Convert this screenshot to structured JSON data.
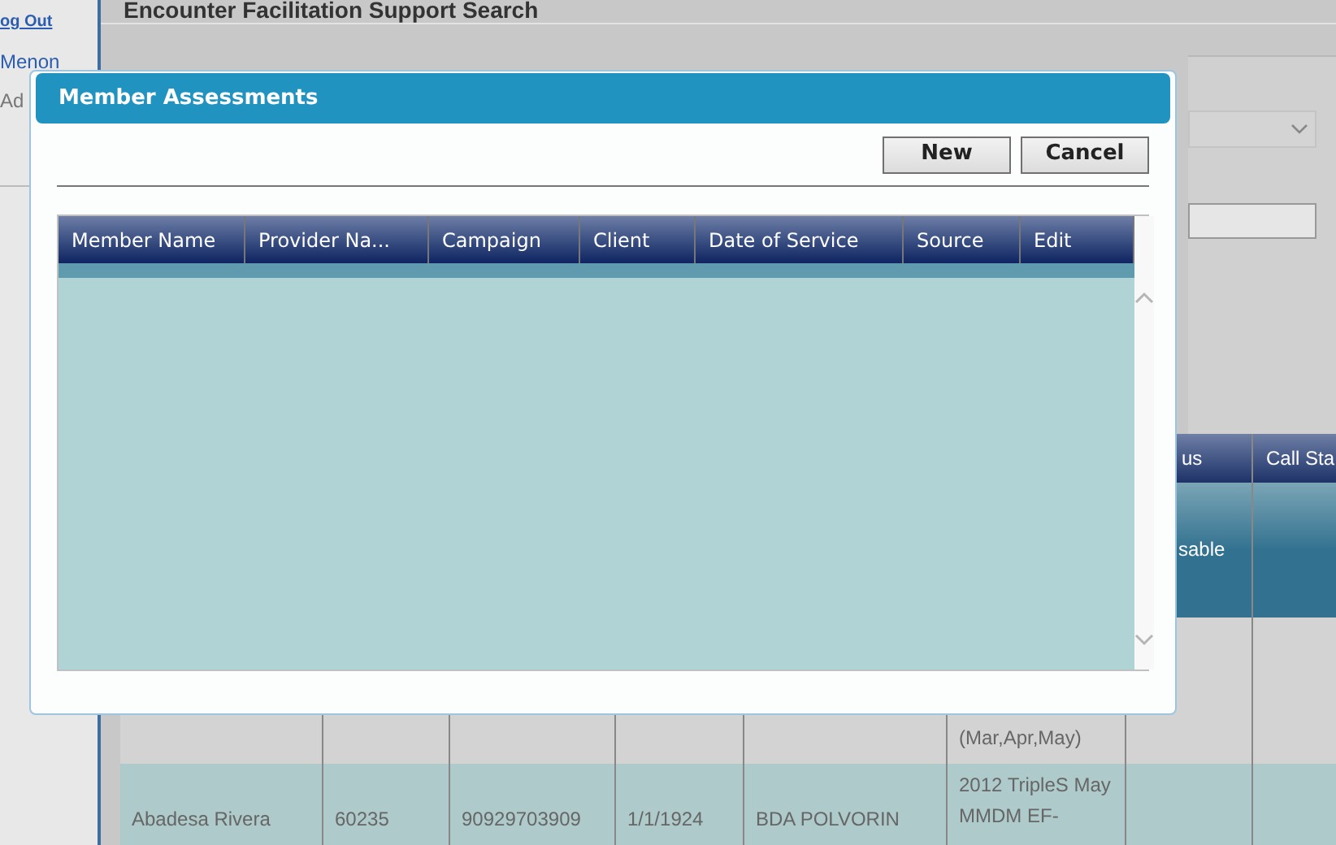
{
  "sidebar": {
    "logout_link": "og Out",
    "user_name": "Menon",
    "role": "Ad"
  },
  "page": {
    "title": "Encounter Facilitation Support Search"
  },
  "results_table": {
    "columns": [
      {},
      {},
      {},
      {},
      {},
      {},
      {
        "label": "us"
      },
      {
        "label": "Call Sta"
      }
    ],
    "rows": [
      {
        "selected": true,
        "cells": [
          "",
          "",
          "",
          "",
          "",
          "",
          "sable",
          ""
        ]
      },
      {
        "selected": false,
        "cells": [
          "",
          "",
          "",
          "",
          "",
          "(Mar,Apr,May)",
          "",
          ""
        ]
      },
      {
        "selected": false,
        "cells": [
          "Abadesa Rivera",
          "60235",
          "90929703909",
          "1/1/1924",
          "BDA POLVORIN",
          "2012 TripleS May MMDM EF-",
          "",
          ""
        ]
      }
    ]
  },
  "dialog": {
    "title": "Member Assessments",
    "buttons": [
      "New",
      "Cancel"
    ],
    "grid": {
      "columns": [
        "Member Name",
        "Provider Na...",
        "Campaign",
        "Client",
        "Date of Service",
        "Source",
        "Edit"
      ]
    }
  }
}
